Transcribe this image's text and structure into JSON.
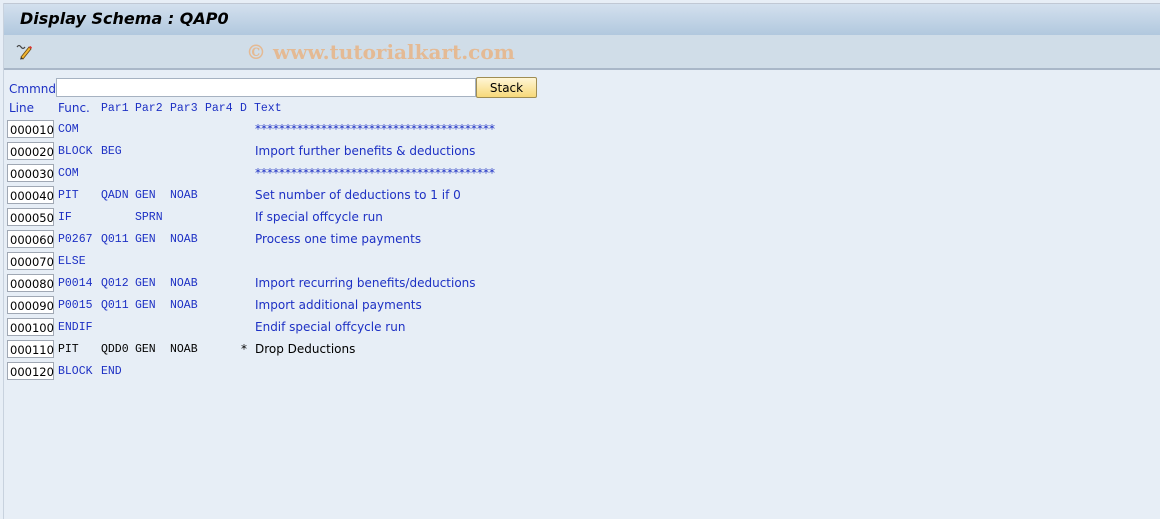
{
  "window": {
    "title": "Display Schema : QAP0",
    "watermark": "© www.tutorialkart.com"
  },
  "toolbar": {
    "icons": [
      {
        "name": "display-change-icon",
        "glyph": "✎"
      }
    ]
  },
  "command": {
    "label": "Cmmnd",
    "value": "",
    "placeholder": "",
    "stack_label": "Stack"
  },
  "table": {
    "headers": {
      "line": "Line",
      "func": "Func.",
      "par1": "Par1",
      "par2": "Par2",
      "par3": "Par3",
      "par4": "Par4",
      "d": "D",
      "text": "Text"
    },
    "rows": [
      {
        "line": "000010",
        "func": "COM",
        "par1": "",
        "par2": "",
        "par3": "",
        "par4": "",
        "d": "",
        "text": "****************************************",
        "inactive": false
      },
      {
        "line": "000020",
        "func": "BLOCK",
        "par1": "BEG",
        "par2": "",
        "par3": "",
        "par4": "",
        "d": "",
        "text": "Import further benefits & deductions",
        "inactive": false
      },
      {
        "line": "000030",
        "func": "COM",
        "par1": "",
        "par2": "",
        "par3": "",
        "par4": "",
        "d": "",
        "text": "****************************************",
        "inactive": false
      },
      {
        "line": "000040",
        "func": "PIT",
        "par1": "QADN",
        "par2": "GEN",
        "par3": "NOAB",
        "par4": "",
        "d": "",
        "text": "Set number of deductions to 1 if 0",
        "inactive": false
      },
      {
        "line": "000050",
        "func": "IF",
        "par1": "",
        "par2": "SPRN",
        "par3": "",
        "par4": "",
        "d": "",
        "text": "If special offcycle run",
        "inactive": false
      },
      {
        "line": "000060",
        "func": "P0267",
        "par1": "Q011",
        "par2": "GEN",
        "par3": "NOAB",
        "par4": "",
        "d": "",
        "text": "Process one time payments",
        "inactive": false
      },
      {
        "line": "000070",
        "func": "ELSE",
        "par1": "",
        "par2": "",
        "par3": "",
        "par4": "",
        "d": "",
        "text": "",
        "inactive": false
      },
      {
        "line": "000080",
        "func": "P0014",
        "par1": "Q012",
        "par2": "GEN",
        "par3": "NOAB",
        "par4": "",
        "d": "",
        "text": "Import recurring benefits/deductions",
        "inactive": false
      },
      {
        "line": "000090",
        "func": "P0015",
        "par1": "Q011",
        "par2": "GEN",
        "par3": "NOAB",
        "par4": "",
        "d": "",
        "text": "Import additional payments",
        "inactive": false
      },
      {
        "line": "000100",
        "func": "ENDIF",
        "par1": "",
        "par2": "",
        "par3": "",
        "par4": "",
        "d": "",
        "text": "Endif special offcycle run",
        "inactive": false
      },
      {
        "line": "000110",
        "func": "PIT",
        "par1": "QDD0",
        "par2": "GEN",
        "par3": "NOAB",
        "par4": "",
        "d": "*",
        "text": "Drop Deductions",
        "inactive": true
      },
      {
        "line": "000120",
        "func": "BLOCK",
        "par1": "END",
        "par2": "",
        "par3": "",
        "par4": "",
        "d": "",
        "text": "",
        "inactive": false
      }
    ]
  },
  "colors": {
    "text_blue": "#1d30c4",
    "button_yellow": "#f7d97a",
    "watermark": "#e8b486"
  }
}
